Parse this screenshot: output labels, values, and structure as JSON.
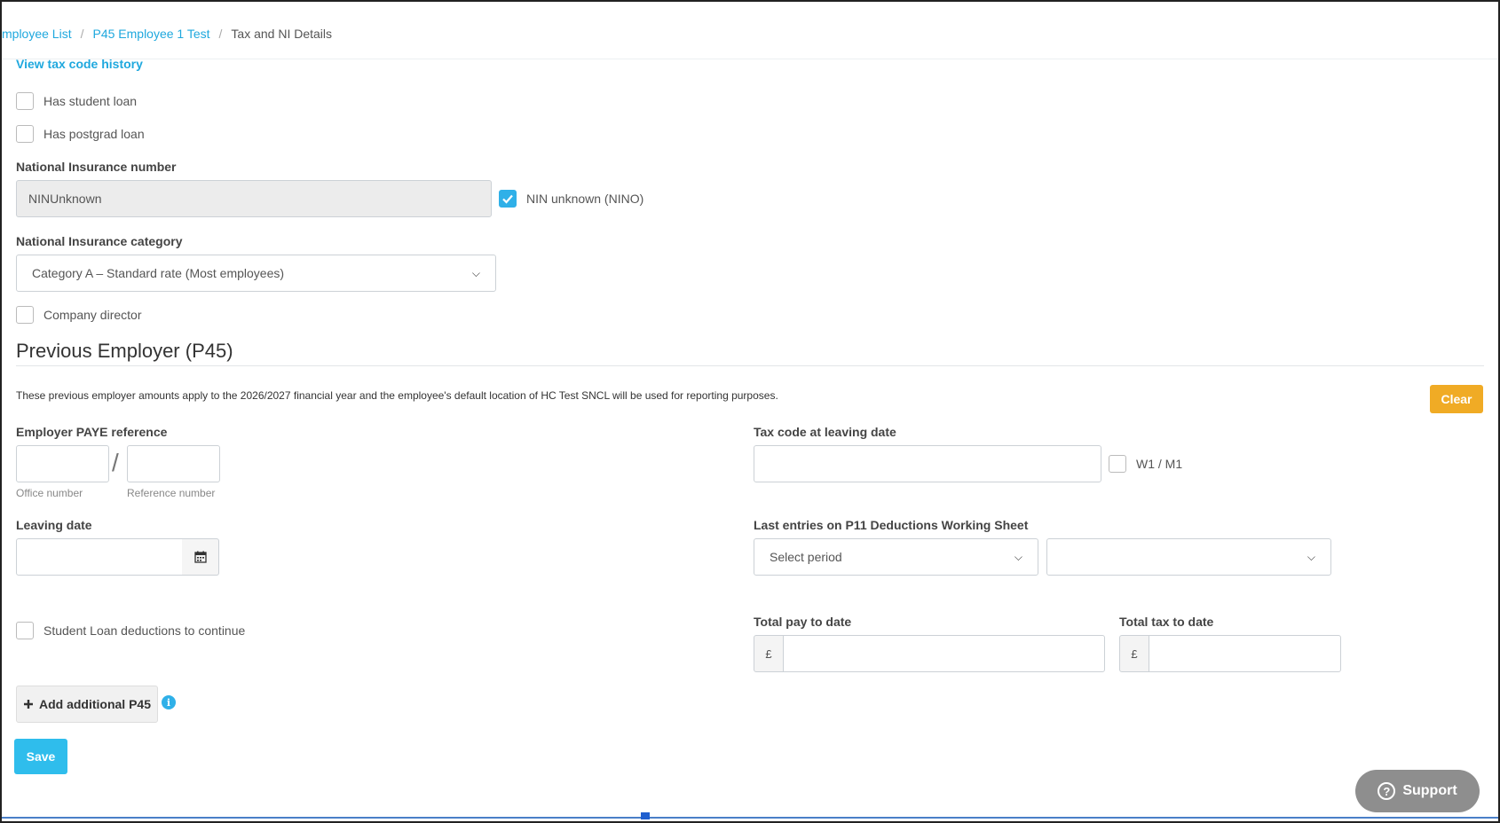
{
  "breadcrumb": {
    "item1": "mployee List",
    "item2": "P45 Employee 1 Test",
    "current": "Tax and NI Details",
    "separator": "/"
  },
  "tax": {
    "view_history_link": "View tax code history"
  },
  "loans": {
    "student_loan_label": "Has student loan",
    "student_loan_checked": false,
    "postgrad_loan_label": "Has postgrad loan",
    "postgrad_loan_checked": false
  },
  "ni": {
    "number_label": "National Insurance number",
    "number_value": "NINUnknown",
    "unknown_label": "NIN unknown (NINO)",
    "unknown_checked": true,
    "category_label": "National Insurance category",
    "category_value": "Category A – Standard rate (Most employees)",
    "company_director_label": "Company director",
    "company_director_checked": false
  },
  "p45": {
    "section_title": "Previous Employer (P45)",
    "notice": "These previous employer amounts apply to the 2026/2027 financial year and the employee's default location of HC Test SNCL will be used for reporting purposes.",
    "clear_button": "Clear",
    "paye_label": "Employer PAYE reference",
    "office_caption": "Office number",
    "reference_caption": "Reference number",
    "paye_slash": "/",
    "leaving_date_label": "Leaving date",
    "tax_code_label": "Tax code at leaving date",
    "w1m1_label": "W1 / M1",
    "p11_label": "Last entries on P11 Deductions Working Sheet",
    "period_placeholder": "Select period",
    "student_loan_continue_label": "Student Loan deductions to continue",
    "total_pay_label": "Total pay to date",
    "total_tax_label": "Total tax to date",
    "currency_symbol": "£",
    "add_p45_button": "Add additional P45",
    "info_icon_glyph": "i"
  },
  "actions": {
    "save_button": "Save",
    "support_button": "Support"
  },
  "colors": {
    "accent": "#2fb0e8",
    "link": "#1fa8de",
    "clear": "#f0ab25",
    "support": "#8e8e8e"
  }
}
